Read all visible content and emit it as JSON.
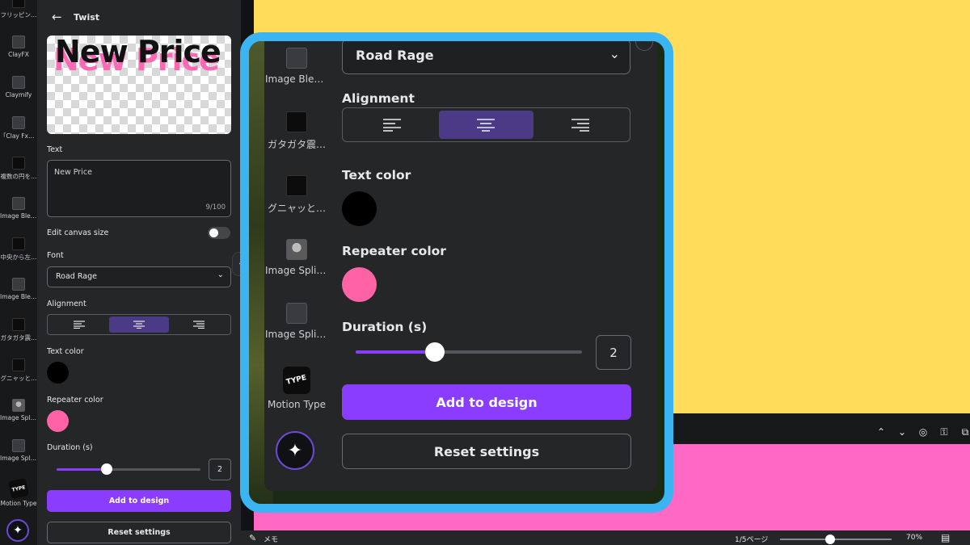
{
  "rail": {
    "items": [
      {
        "label": "フリッピン…",
        "thumb": "dark"
      },
      {
        "label": "ClayFX",
        "thumb": "plain"
      },
      {
        "label": "Claymify",
        "thumb": "plain"
      },
      {
        "label": "「Clay Fx」…",
        "thumb": "plain"
      },
      {
        "label": "複数の円を…",
        "thumb": "dark"
      },
      {
        "label": "Image Blen…",
        "thumb": "plain"
      },
      {
        "label": "中央から左…",
        "thumb": "dark"
      },
      {
        "label": "Image Blen…",
        "thumb": "plain"
      },
      {
        "label": "ガタガタ震…",
        "thumb": "dark"
      },
      {
        "label": "グニャッと…",
        "thumb": "dark"
      },
      {
        "label": "Image Split…",
        "thumb": "face"
      },
      {
        "label": "Image Spliter",
        "thumb": "plain"
      },
      {
        "label": "Motion Type",
        "thumb": "motion"
      }
    ],
    "motion_glyph": "TYPE",
    "magic_icon": "sparkle-icon"
  },
  "panel": {
    "title": "Twist",
    "preview_text": "New Price",
    "text_label": "Text",
    "text_value": "New Price",
    "text_count": "9/100",
    "edit_canvas_label": "Edit canvas size",
    "edit_canvas_on": false,
    "font_label": "Font",
    "font_value": "Road Rage",
    "alignment_label": "Alignment",
    "alignment_selected": "center",
    "text_color_label": "Text color",
    "text_color": "#000000",
    "repeater_color_label": "Repeater color",
    "repeater_color": "#ff63a5",
    "duration_label": "Duration (s)",
    "duration_value": "2",
    "duration_fraction": 0.35,
    "add_button": "Add to design",
    "reset_button": "Reset settings"
  },
  "zoom": {
    "rail_items": [
      {
        "label": "Image Blen…",
        "thumb": "plain"
      },
      {
        "label": "ガタガタ震…",
        "thumb": "dark"
      },
      {
        "label": "グニャッと…",
        "thumb": "dark"
      },
      {
        "label": "Image Split…",
        "thumb": "face"
      },
      {
        "label": "Image Spliter",
        "thumb": "plain"
      },
      {
        "label": "Motion Type",
        "thumb": "motion"
      }
    ],
    "font_value": "Road Rage",
    "alignment_label": "Alignment",
    "text_color_label": "Text color",
    "repeater_color_label": "Repeater color",
    "duration_label": "Duration (s)",
    "duration_value": "2",
    "duration_fraction": 0.35,
    "add_button": "Add to design",
    "reset_button": "Reset settings"
  },
  "bottom_bar": {
    "memo_label": "メモ",
    "page_label": "1/5ページ",
    "zoom_label": "70%",
    "zoom_fraction": 0.45
  },
  "colors": {
    "canvas_yellow": "#ffdc5a",
    "canvas_pink": "#ff68c4",
    "accent": "#8b3dff",
    "callout": "#3ab4f2"
  }
}
